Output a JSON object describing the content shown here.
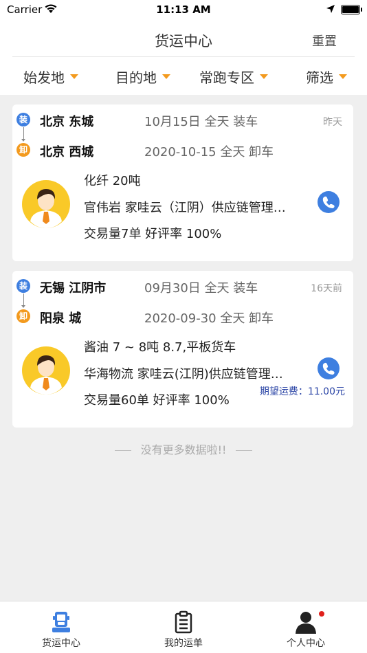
{
  "status_bar": {
    "carrier": "Carrier",
    "time": "11:13 AM"
  },
  "header": {
    "title": "货运中心",
    "reset_label": "重置"
  },
  "filters": [
    {
      "label": "始发地"
    },
    {
      "label": "目的地"
    },
    {
      "label": "常跑专区"
    },
    {
      "label": "筛选"
    }
  ],
  "colors": {
    "accent": "#3e7fe0",
    "orange": "#f39a1e",
    "price": "#2b45a6",
    "badge": "#e0201c"
  },
  "orders": [
    {
      "load_tag": "装",
      "unload_tag": "卸",
      "origin": "北京 东城",
      "load_time": "10月15日 全天 装车",
      "destination": "北京 西城",
      "unload_time": "2020-10-15 全天 卸车",
      "posted": "昨天",
      "cargo": "化纤  20吨",
      "shipper": "官伟岩 家哇云（江阴）供应链管理…",
      "stats": "交易量7单 好评率 100%",
      "price": ""
    },
    {
      "load_tag": "装",
      "unload_tag": "卸",
      "origin": "无锡 江阴市",
      "load_time": "09月30日 全天 装车",
      "destination": "阳泉 城",
      "unload_time": "2020-09-30 全天 卸车",
      "posted": "16天前",
      "cargo": "酱油 7 ~ 8吨 8.7,平板货车",
      "shipper": "华海物流   家哇云(江阴)供应链管理…",
      "stats": "交易量60单 好评率 100%",
      "price": "期望运费：11.00元"
    }
  ],
  "footer_text": "没有更多数据啦!!",
  "tabs": [
    {
      "label": "货运中心",
      "icon": "truck-icon",
      "active": true
    },
    {
      "label": "我的运单",
      "icon": "clipboard-icon",
      "active": false
    },
    {
      "label": "个人中心",
      "icon": "person-icon",
      "active": false
    }
  ]
}
